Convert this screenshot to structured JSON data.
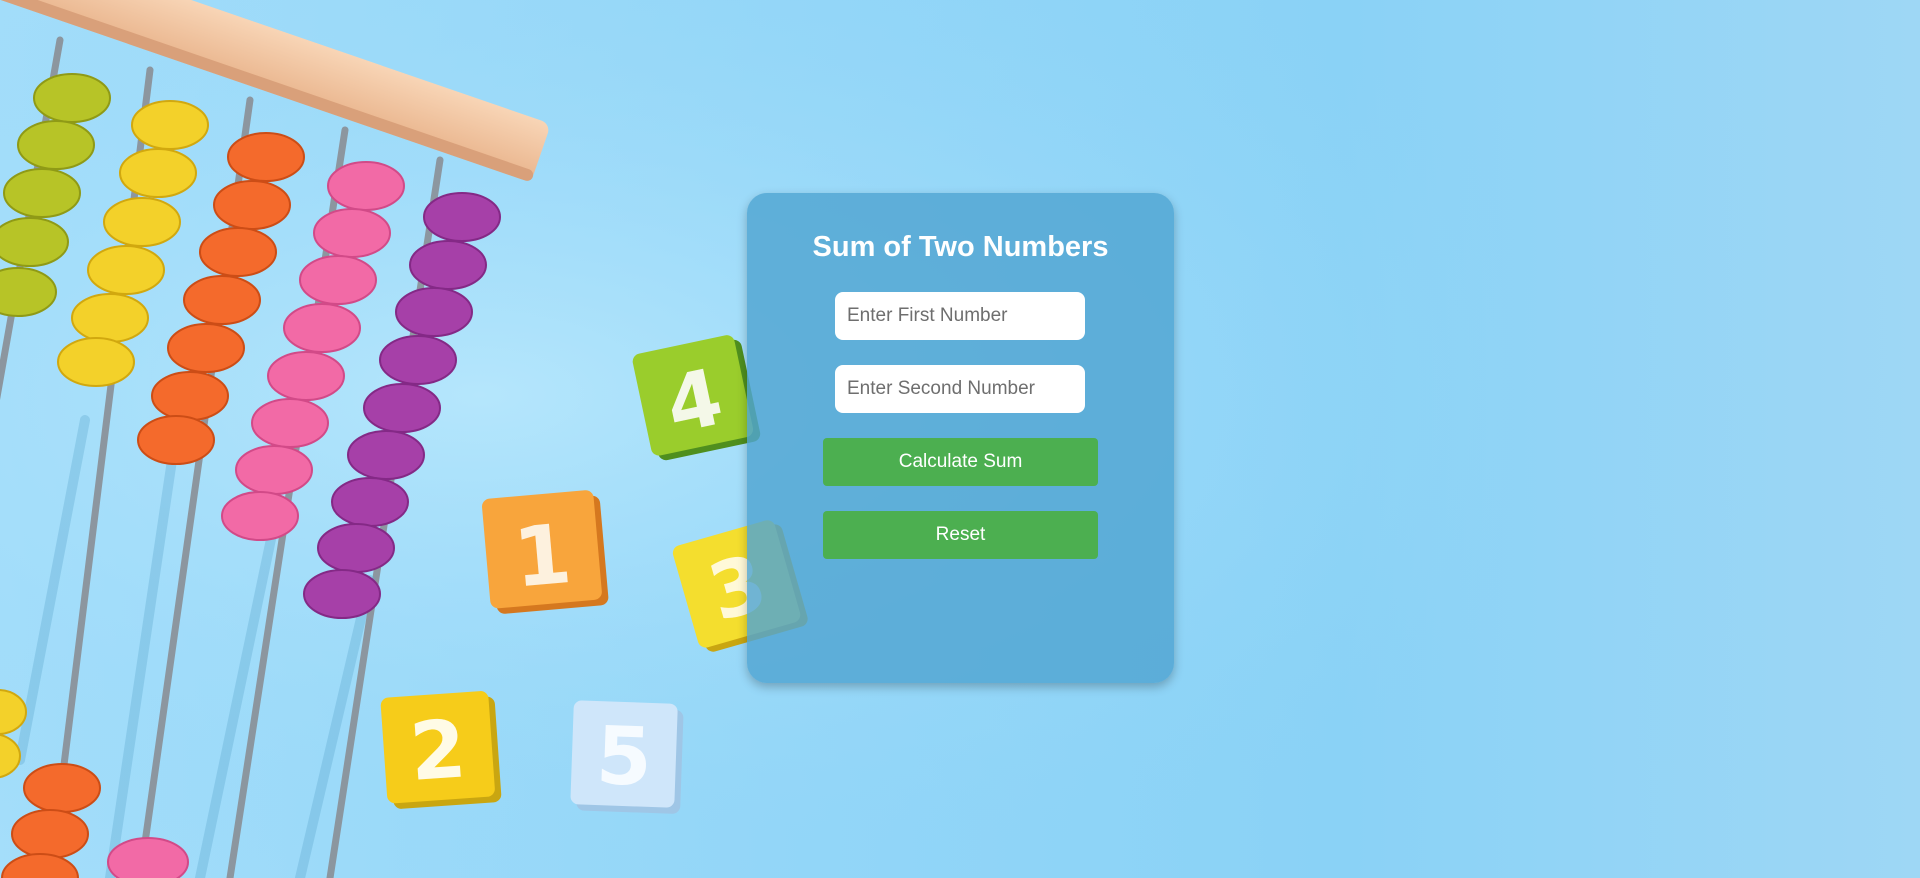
{
  "form": {
    "title": "Sum of Two Numbers",
    "first_placeholder": "Enter First Number",
    "second_placeholder": "Enter Second Number",
    "first_value": "",
    "second_value": "",
    "calculate_label": "Calculate Sum",
    "reset_label": "Reset",
    "button_color": "#4caf50"
  },
  "background": {
    "subject": "abacus-and-number-blocks",
    "blocks": [
      "4",
      "1",
      "3",
      "2",
      "5"
    ],
    "sky_color": "#93d6f8"
  }
}
